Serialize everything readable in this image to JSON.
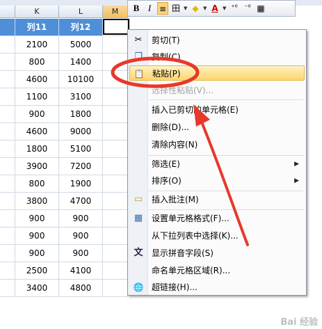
{
  "sheet": {
    "col_letters": [
      "K",
      "L",
      "M"
    ],
    "header_row": [
      "列11",
      "列12"
    ],
    "rows": [
      [
        "2100",
        "5000"
      ],
      [
        "800",
        "1400"
      ],
      [
        "4600",
        "10100"
      ],
      [
        "1100",
        "3100"
      ],
      [
        "900",
        "1800"
      ],
      [
        "4600",
        "9000"
      ],
      [
        "1800",
        "5100"
      ],
      [
        "3900",
        "7200"
      ],
      [
        "800",
        "1900"
      ],
      [
        "3800",
        "4700"
      ],
      [
        "900",
        "900"
      ],
      [
        "900",
        "900"
      ],
      [
        "900",
        "900"
      ],
      [
        "2500",
        "4100"
      ],
      [
        "3400",
        "4800"
      ]
    ]
  },
  "mini_toolbar": {
    "bold": "B",
    "italic": "I",
    "align": "≡",
    "borders": "田",
    "fill": "◆",
    "font_color": "A",
    "inc_decimal": "⁺⁰",
    "dec_decimal": "⁻⁰",
    "format": "▦"
  },
  "menu": {
    "items": [
      {
        "label": "剪切(T)",
        "icon": "scissors-icon",
        "glyph": "✂"
      },
      {
        "label": "复制(C)",
        "icon": "copy-icon",
        "glyph": "❐"
      },
      {
        "label": "粘贴(P)",
        "icon": "paste-icon",
        "glyph": "📋"
      },
      {
        "label": "选择性粘贴(V)..."
      },
      {
        "label": "插入已剪切的单元格(E)"
      },
      {
        "label": "删除(D)..."
      },
      {
        "label": "清除内容(N)"
      },
      {
        "label": "筛选(E)"
      },
      {
        "label": "排序(O)"
      },
      {
        "label": "插入批注(M)",
        "icon": "comment-icon",
        "glyph": "▭"
      },
      {
        "label": "设置单元格格式(F)...",
        "icon": "format-cells-icon",
        "glyph": "▦"
      },
      {
        "label": "从下拉列表中选择(K)..."
      },
      {
        "label": "显示拼音字段(S)",
        "icon": "phonetic-icon",
        "glyph": "文"
      },
      {
        "label": "命名单元格区域(R)..."
      },
      {
        "label": "超链接(H)...",
        "icon": "hyperlink-icon",
        "glyph": "🌐"
      }
    ],
    "submenu_arrow": "▶"
  },
  "annotation": {
    "circle_color": "#e8382b",
    "arrow_color": "#e8382b"
  },
  "watermark": "Bai 经验"
}
